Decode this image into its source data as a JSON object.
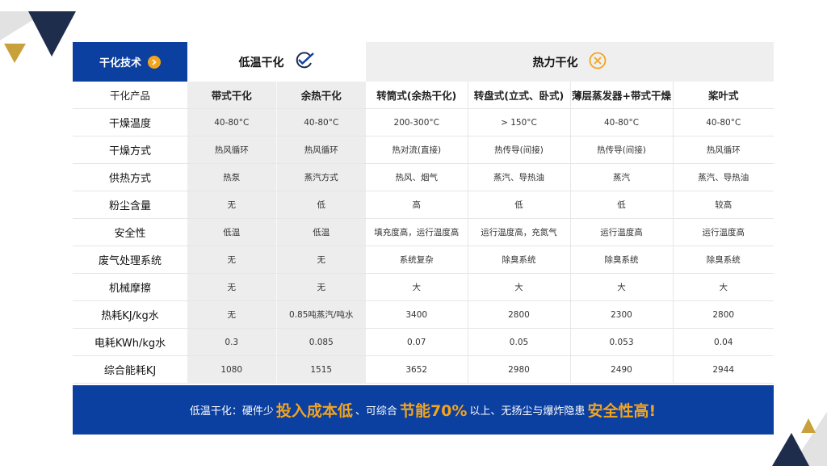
{
  "table": {
    "corner_label": "干化技术",
    "group_low": "低温干化",
    "group_thermal": "热力干化",
    "columns": [
      "干化产品",
      "带式干化",
      "余热干化",
      "转筒式(余热干化)",
      "转盘式(立式、卧式)",
      "薄层蒸发器+带式干燥",
      "桨叶式"
    ],
    "rows": [
      [
        "干燥温度",
        "40-80°C",
        "40-80°C",
        "200-300°C",
        "> 150°C",
        "40-80°C",
        "40-80°C"
      ],
      [
        "干燥方式",
        "热风循环",
        "热风循环",
        "热对流(直接)",
        "热传导(间接)",
        "热传导(间接)",
        "热风循环"
      ],
      [
        "供热方式",
        "热泵",
        "蒸汽方式",
        "热风、烟气",
        "蒸汽、导热油",
        "蒸汽",
        "蒸汽、导热油"
      ],
      [
        "粉尘含量",
        "无",
        "低",
        "高",
        "低",
        "低",
        "较高"
      ],
      [
        "安全性",
        "低温",
        "低温",
        "填充度高，运行温度高",
        "运行温度高，充氮气",
        "运行温度高",
        "运行温度高"
      ],
      [
        "废气处理系统",
        "无",
        "无",
        "系统复杂",
        "除臭系统",
        "除臭系统",
        "除臭系统"
      ],
      [
        "机械摩擦",
        "无",
        "无",
        "大",
        "大",
        "大",
        "大"
      ],
      [
        "热耗KJ/kg水",
        "无",
        "0.85吨蒸汽/吨水",
        "3400",
        "2800",
        "2300",
        "2800"
      ],
      [
        "电耗KWh/kg水",
        "0.3",
        "0.085",
        "0.07",
        "0.05",
        "0.053",
        "0.04"
      ],
      [
        "综合能耗KJ",
        "1080",
        "1515",
        "3652",
        "2980",
        "2490",
        "2944"
      ]
    ]
  },
  "banner": {
    "part1": "低温干化：硬件少",
    "hl1": "投入成本低",
    "part2": "、可综合",
    "hl2": "节能70%",
    "part3": "以上、无扬尘与爆炸隐患",
    "hl3": "安全性高!"
  },
  "colors": {
    "brand_blue": "#0b3fa0",
    "accent_orange": "#f2a41e",
    "navy": "#1f2d4d"
  }
}
